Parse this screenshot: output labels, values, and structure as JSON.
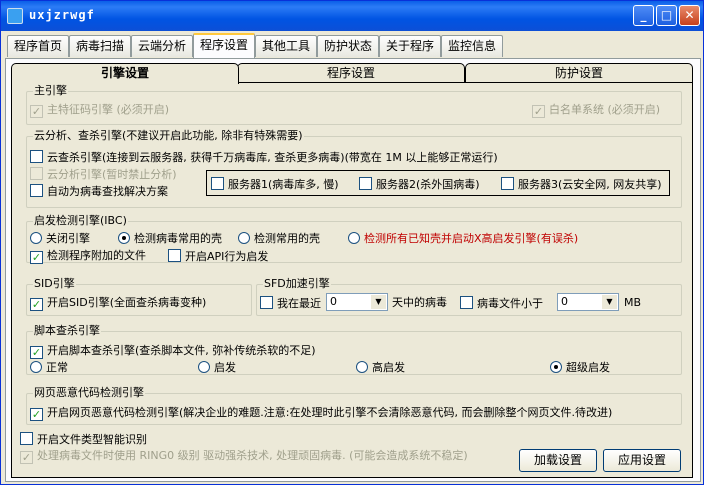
{
  "window": {
    "title": "uxjzrwgf",
    "min_label": "_",
    "max_label": "□",
    "close_label": "✕",
    "accent": "#0054e3"
  },
  "main_tabs": [
    "程序首页",
    "病毒扫描",
    "云端分析",
    "程序设置",
    "其他工具",
    "防护状态",
    "关于程序",
    "监控信息"
  ],
  "sub_tabs": [
    "引擎设置",
    "程序设置",
    "防护设置"
  ],
  "main_engine": {
    "title": "主引擎",
    "signature": "主特征码引擎 (必须开启)",
    "whitelist": "白名单系统 (必须开启)"
  },
  "cloud": {
    "title": "云分析、查杀引擎(不建议开启此功能, 除非有特殊需要)",
    "cloud_kill": "云查杀引擎(连接到云服务器, 获得千万病毒库, 查杀更多病毒)(带宽在 1M 以上能够正常运行)",
    "cloud_analysis": "云分析引擎(暂时禁止分析)",
    "auto_solution": "自动为病毒查找解决方案",
    "servers": [
      "服务器1(病毒库多, 慢)",
      "服务器2(杀外国病毒)",
      "服务器3(云安全网, 网友共享)"
    ]
  },
  "heuristic": {
    "title": "启发检测引擎(IBC)",
    "options": [
      "关闭引擎",
      "检测病毒常用的壳",
      "检测常用的壳",
      "检测所有已知壳并启动X高启发引擎(有误杀)"
    ],
    "attached_files": "检测程序附加的文件",
    "api_behavior": "开启API行为启发"
  },
  "sid": {
    "title": "SID引擎",
    "enable": "开启SID引擎(全面查杀病毒变种)"
  },
  "sfd": {
    "title": "SFD加速引擎",
    "recent_prefix": "我在最近",
    "recent_value": "0",
    "recent_suffix": "天中的病毒",
    "size_prefix": "病毒文件小于",
    "size_value": "0",
    "size_unit": "MB"
  },
  "script": {
    "title": "脚本查杀引擎",
    "enable": "开启脚本查杀引擎(查杀脚本文件, 弥补传统杀软的不足)",
    "levels": [
      "正常",
      "启发",
      "高启发",
      "超级启发"
    ]
  },
  "web": {
    "title": "网页恶意代码检测引擎",
    "enable": "开启网页恶意代码检测引擎(解决企业的难题.注意:在处理时此引擎不会清除恶意代码, 而会删除整个网页文件.待改进)"
  },
  "bottom": {
    "file_type": "开启文件类型智能识别",
    "ring0": "处理病毒文件时使用 RING0 级别 驱动强杀技术, 处理顽固病毒. (可能会造成系统不稳定)",
    "load_button": "加载设置",
    "apply_button": "应用设置"
  }
}
